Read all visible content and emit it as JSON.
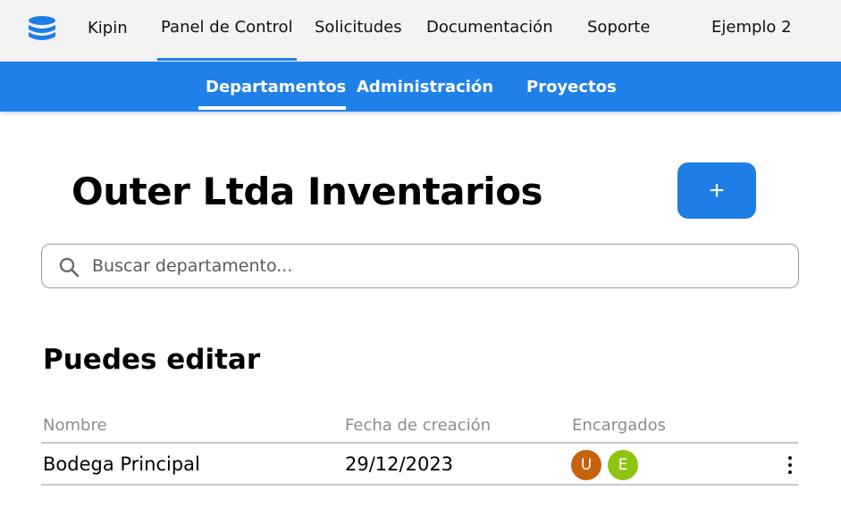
{
  "brand": {
    "name": "Kipin",
    "icon": "database-icon",
    "color": "#1e7de6"
  },
  "topnav": [
    {
      "label": "Panel de Control",
      "active": true
    },
    {
      "label": "Solicitudes",
      "active": false
    },
    {
      "label": "Documentación",
      "active": false
    },
    {
      "label": "Soporte",
      "active": false
    },
    {
      "label": "Ejemplo 2",
      "active": false
    }
  ],
  "subnav": [
    {
      "label": "Departamentos",
      "active": true
    },
    {
      "label": "Administración",
      "active": false
    },
    {
      "label": "Proyectos",
      "active": false
    }
  ],
  "page": {
    "title": "Outer Ltda Inventarios",
    "add_label": "+",
    "accent": "#1e7de6"
  },
  "search": {
    "placeholder": "Buscar departamento...",
    "value": "",
    "icon": "search-icon"
  },
  "section": {
    "title": "Puedes editar"
  },
  "table": {
    "columns": [
      "Nombre",
      "Fecha de creación",
      "Encargados"
    ],
    "rows": [
      {
        "name": "Bodega Principal",
        "created": "29/12/2023",
        "managers": [
          {
            "initial": "U",
            "color": "#c8620d"
          },
          {
            "initial": "E",
            "color": "#8fc412"
          }
        ],
        "menu_icon": "more-vertical-icon"
      }
    ]
  }
}
